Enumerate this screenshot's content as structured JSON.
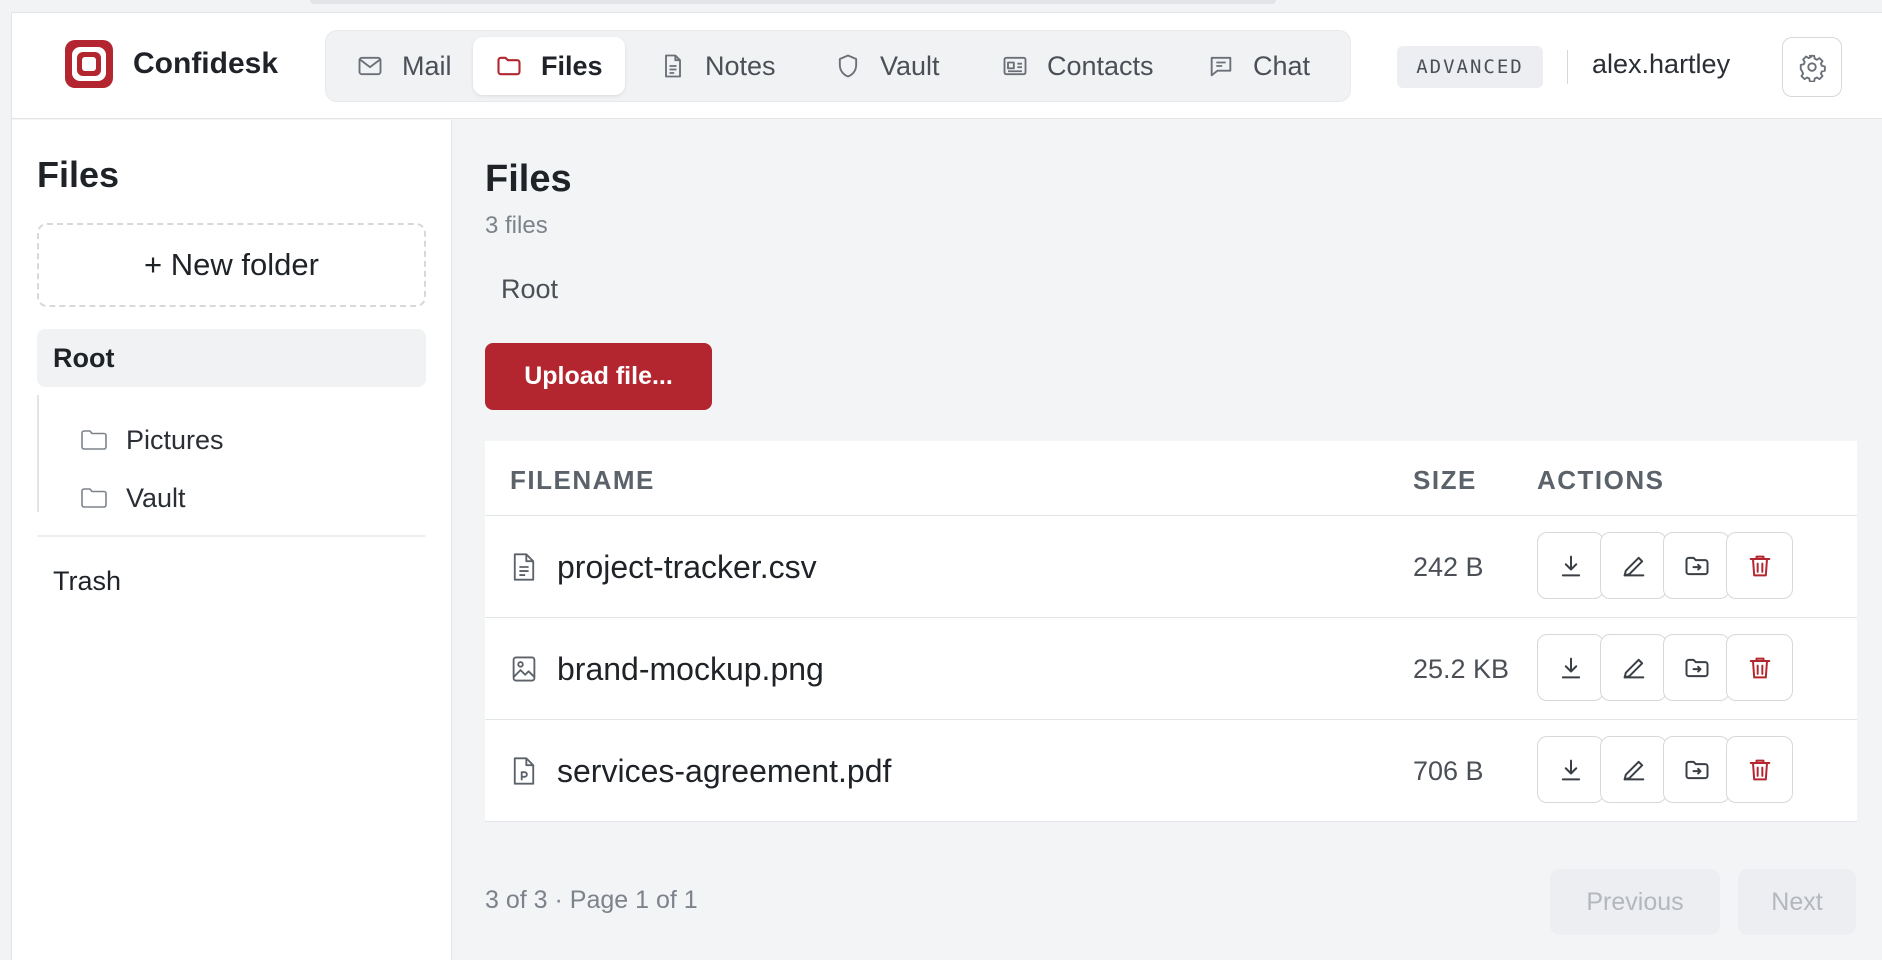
{
  "app": {
    "name": "Confidesk"
  },
  "nav": {
    "tabs": [
      {
        "label": "Mail",
        "icon": "mail-icon"
      },
      {
        "label": "Files",
        "icon": "folder-icon",
        "active": true
      },
      {
        "label": "Notes",
        "icon": "note-icon"
      },
      {
        "label": "Vault",
        "icon": "shield-icon"
      },
      {
        "label": "Contacts",
        "icon": "contact-card-icon"
      },
      {
        "label": "Chat",
        "icon": "chat-icon"
      }
    ]
  },
  "header": {
    "mode_badge": "ADVANCED",
    "username": "alex.hartley"
  },
  "sidebar": {
    "title": "Files",
    "new_folder_label": "+ New folder",
    "root_label": "Root",
    "folders": [
      {
        "label": "Pictures"
      },
      {
        "label": "Vault"
      }
    ],
    "trash_label": "Trash"
  },
  "main": {
    "title": "Files",
    "file_count": "3 files",
    "breadcrumb": "Root",
    "upload_label": "Upload file...",
    "columns": {
      "filename": "FILENAME",
      "size": "SIZE",
      "actions": "ACTIONS"
    },
    "files": [
      {
        "name": "project-tracker.csv",
        "size": "242 B",
        "icon": "text-file-icon"
      },
      {
        "name": "brand-mockup.png",
        "size": "25.2 KB",
        "icon": "image-file-icon"
      },
      {
        "name": "services-agreement.pdf",
        "size": "706 B",
        "icon": "pdf-file-icon"
      }
    ],
    "pagination": {
      "info": "3 of 3 · Page 1 of 1",
      "previous": "Previous",
      "next": "Next"
    }
  },
  "colors": {
    "accent": "#b3262f",
    "background": "#f3f4f6",
    "surface": "#ffffff"
  }
}
